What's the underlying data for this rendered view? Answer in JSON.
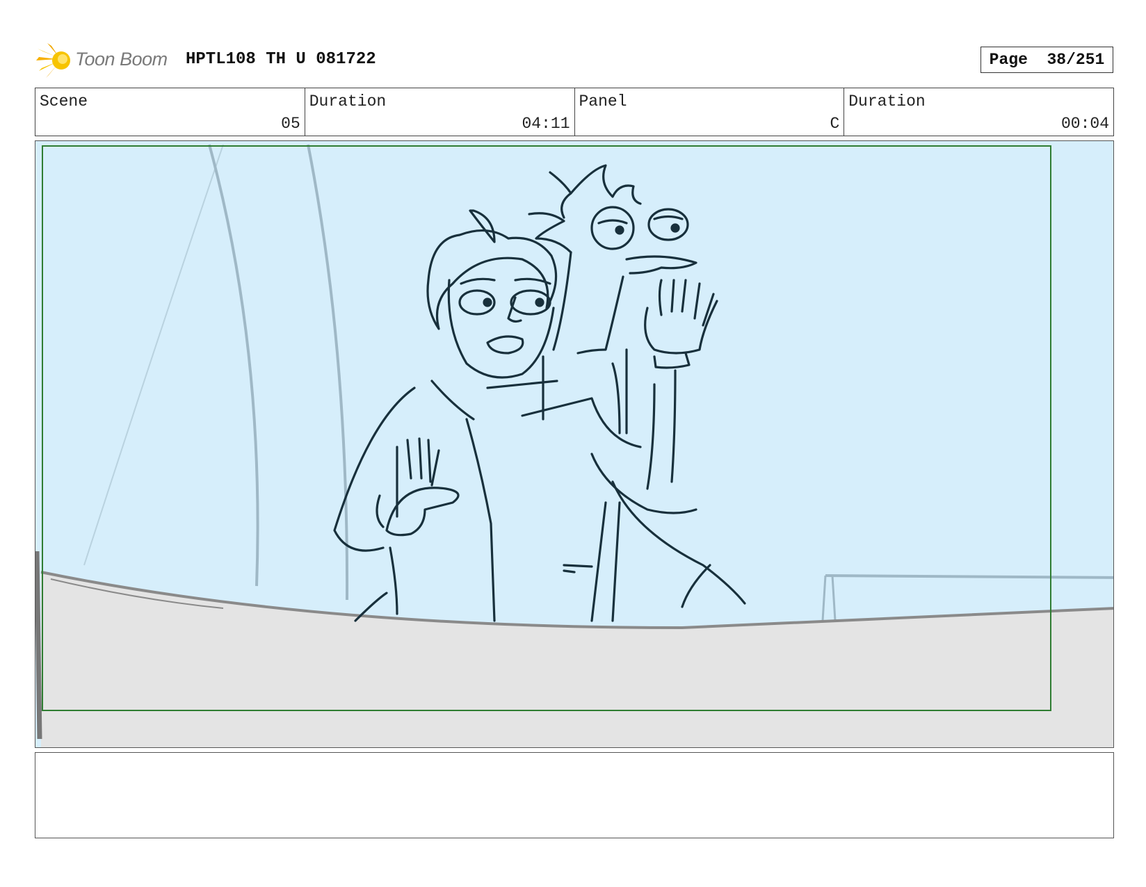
{
  "header": {
    "logo_text": "Toon Boom",
    "doc_title": "HPTL108 TH U 081722",
    "page_label": "Page",
    "page_number": "38/251"
  },
  "info": {
    "scene_label": "Scene",
    "scene_value": "05",
    "scene_duration_label": "Duration",
    "scene_duration_value": "04:11",
    "panel_label": "Panel",
    "panel_value": "C",
    "panel_duration_label": "Duration",
    "panel_duration_value": "00:04"
  },
  "colors": {
    "sky": "#d6eefb",
    "ground": "#e4e4e4",
    "frame_green": "#2f7d32",
    "ink": "#18303c",
    "logo_yellow": "#f7c400"
  },
  "icons": {
    "logo": "toon-boom-star-icon"
  }
}
